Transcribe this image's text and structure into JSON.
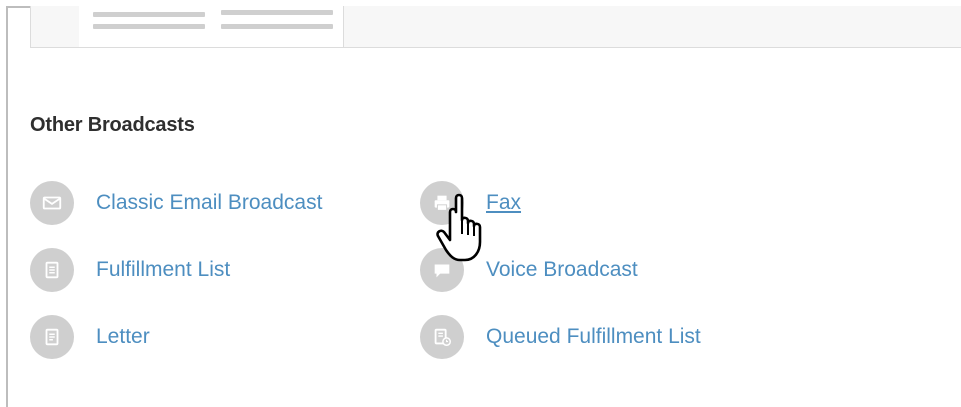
{
  "section": {
    "title": "Other Broadcasts"
  },
  "broadcasts": {
    "items": [
      {
        "label": "Classic Email Broadcast",
        "icon": "envelope-icon"
      },
      {
        "label": "Fax",
        "icon": "printer-icon"
      },
      {
        "label": "Fulfillment List",
        "icon": "list-document-icon"
      },
      {
        "label": "Voice Broadcast",
        "icon": "speech-bubble-icon"
      },
      {
        "label": "Letter",
        "icon": "letter-document-icon"
      },
      {
        "label": "Queued Fulfillment List",
        "icon": "queued-list-icon"
      }
    ]
  },
  "colors": {
    "link": "#4d8ec0",
    "icon_circle": "#cfcfcf",
    "title": "#2f2f2f"
  }
}
